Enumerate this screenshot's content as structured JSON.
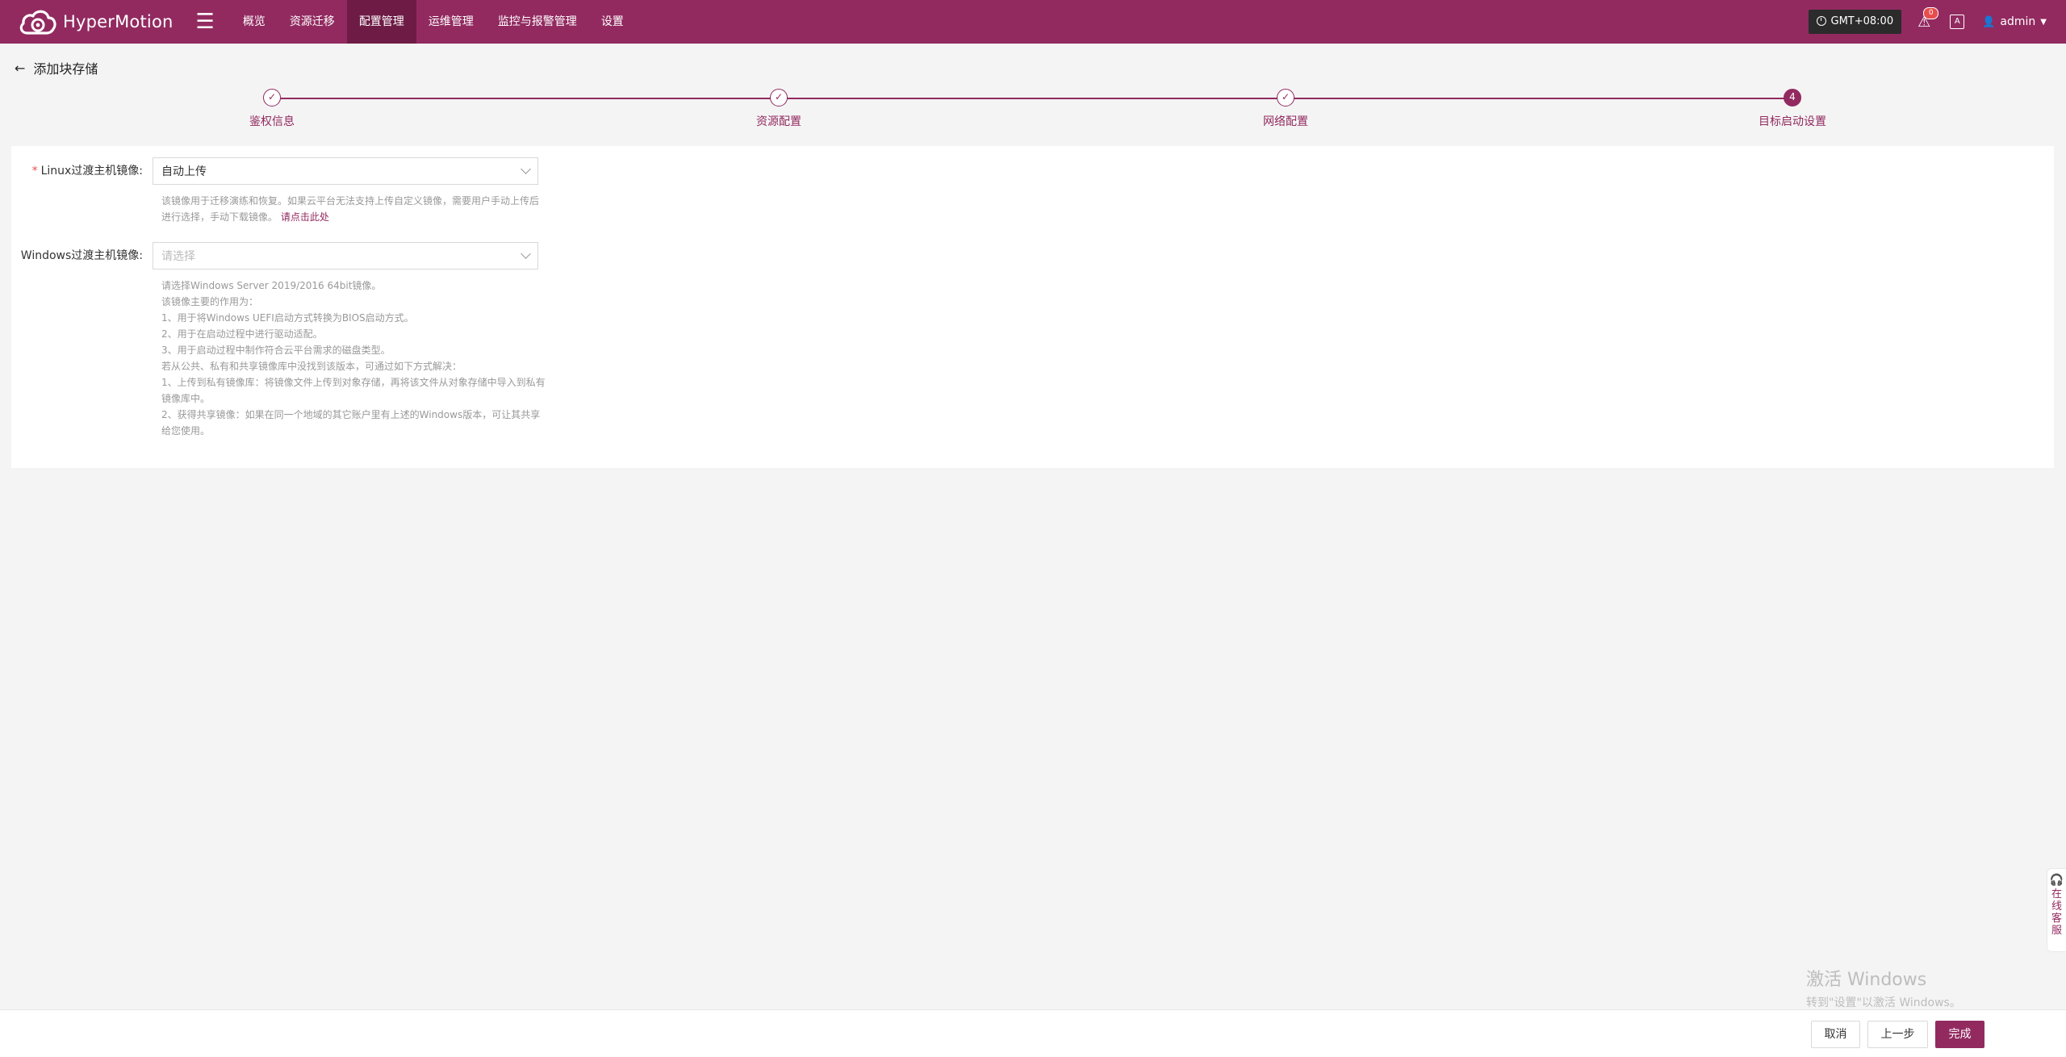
{
  "app": {
    "name": "HyperMotion"
  },
  "nav": {
    "items": [
      "概览",
      "资源迁移",
      "配置管理",
      "运维管理",
      "监控与报警管理",
      "设置"
    ],
    "active_index": 2
  },
  "topbar": {
    "timezone": "GMT+08:00",
    "alert_count": "0",
    "lang_icon_text": "A",
    "user": "admin"
  },
  "page": {
    "title": "添加块存储"
  },
  "steps": [
    {
      "label": "鉴权信息",
      "status": "done"
    },
    {
      "label": "资源配置",
      "status": "done"
    },
    {
      "label": "网络配置",
      "status": "done"
    },
    {
      "label": "目标启动设置",
      "status": "current",
      "number": "4"
    }
  ],
  "form": {
    "linux": {
      "label": "Linux过渡主机镜像:",
      "required": true,
      "value": "自动上传",
      "help": "该镜像用于迁移演练和恢复。如果云平台无法支持上传自定义镜像，需要用户手动上传后进行选择，手动下载镜像。",
      "help_link": "请点击此处"
    },
    "windows": {
      "label": "Windows过渡主机镜像:",
      "required": false,
      "placeholder": "请选择",
      "help_lines": [
        "请选择Windows Server 2019/2016 64bit镜像。",
        "该镜像主要的作用为：",
        "1、用于将Windows UEFI启动方式转换为BIOS启动方式。",
        "2、用于在启动过程中进行驱动适配。",
        "3、用于启动过程中制作符合云平台需求的磁盘类型。",
        "若从公共、私有和共享镜像库中没找到该版本，可通过如下方式解决：",
        "1、上传到私有镜像库：将镜像文件上传到对象存储，再将该文件从对象存储中导入到私有镜像库中。",
        "2、获得共享镜像：如果在同一个地域的其它账户里有上述的Windows版本，可让其共享给您使用。"
      ]
    }
  },
  "service": {
    "label": "在线客服"
  },
  "watermark": {
    "line1": "激活 Windows",
    "line2": "转到\"设置\"以激活 Windows。"
  },
  "footer": {
    "cancel": "取消",
    "prev": "上一步",
    "finish": "完成"
  },
  "colors": {
    "brand": "#922a60",
    "brand_dark": "#6e1c46",
    "badge": "#e84d4d"
  }
}
